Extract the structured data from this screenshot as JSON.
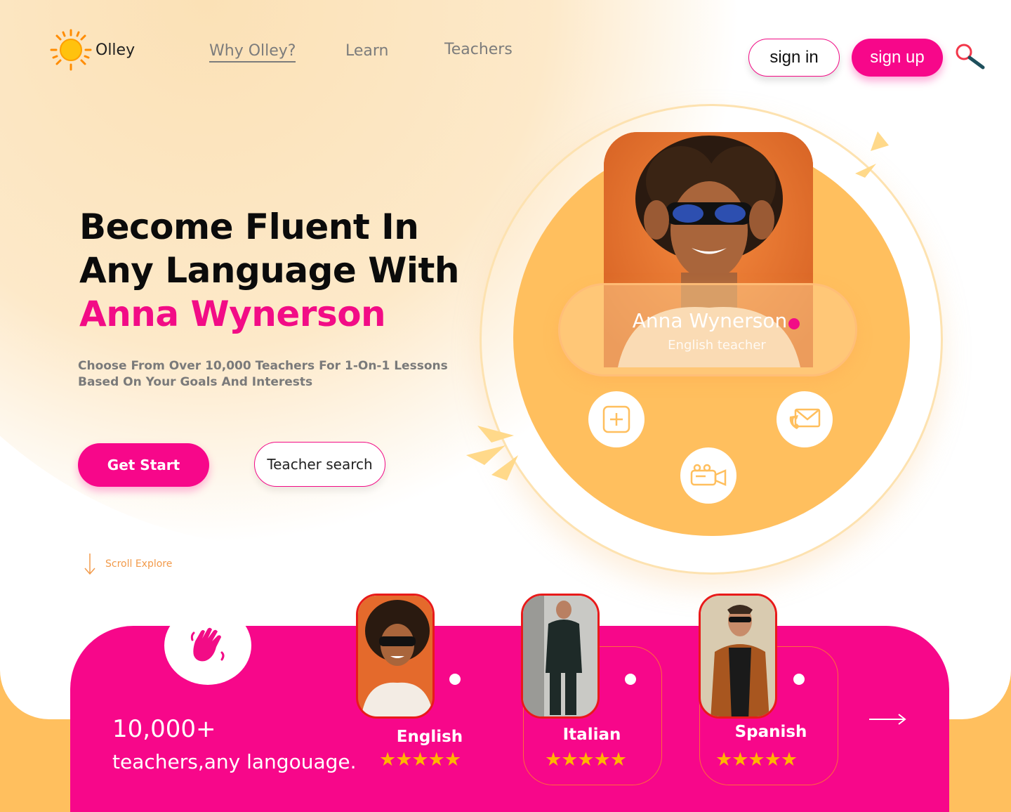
{
  "brand": {
    "name": "Olley"
  },
  "nav": {
    "links": [
      {
        "label": "Why Olley?",
        "active": true
      },
      {
        "label": "Learn",
        "active": false
      },
      {
        "label": "Teachers",
        "active": false
      }
    ],
    "signin_label": "sign in",
    "signup_label": "sign up",
    "search_icon": "search-icon"
  },
  "hero": {
    "title_line1": "Become Fluent In",
    "title_line2": "Any Language With",
    "title_accent": "Anna Wynerson",
    "subtitle_line1": "Choose From Over 10,000 Teachers For 1-On-1 Lessons",
    "subtitle_line2": "Based On Your Goals And Interests",
    "primary_cta": "Get Start",
    "secondary_cta": "Teacher search",
    "scroll_label": "Scroll Explore"
  },
  "profile": {
    "name": "Anna Wynerson",
    "role": "English teacher",
    "actions": [
      "add-icon",
      "video-camera-icon",
      "mail-call-icon"
    ]
  },
  "stats": {
    "count": "10,000+",
    "label": "teachers,any langouage."
  },
  "languages": [
    {
      "name": "English",
      "rating": 5
    },
    {
      "name": "Italian",
      "rating": 5
    },
    {
      "name": "Spanish",
      "rating": 5
    }
  ],
  "colors": {
    "brand_pink": "#f7078a",
    "brand_orange": "#ffbf5e",
    "star": "#ffb500"
  }
}
